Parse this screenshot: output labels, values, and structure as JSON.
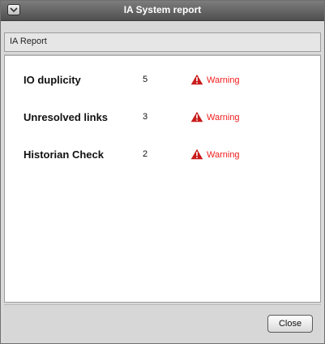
{
  "window": {
    "title": "IA System report"
  },
  "section": {
    "label": "IA Report"
  },
  "report": {
    "rows": [
      {
        "name": "IO duplicity",
        "count": "5",
        "status": "Warning"
      },
      {
        "name": "Unresolved links",
        "count": "3",
        "status": "Warning"
      },
      {
        "name": "Historian Check",
        "count": "2",
        "status": "Warning"
      }
    ]
  },
  "footer": {
    "close_label": "Close"
  },
  "colors": {
    "warning_text": "#f21b1b",
    "warning_icon": "#c81b1b"
  }
}
